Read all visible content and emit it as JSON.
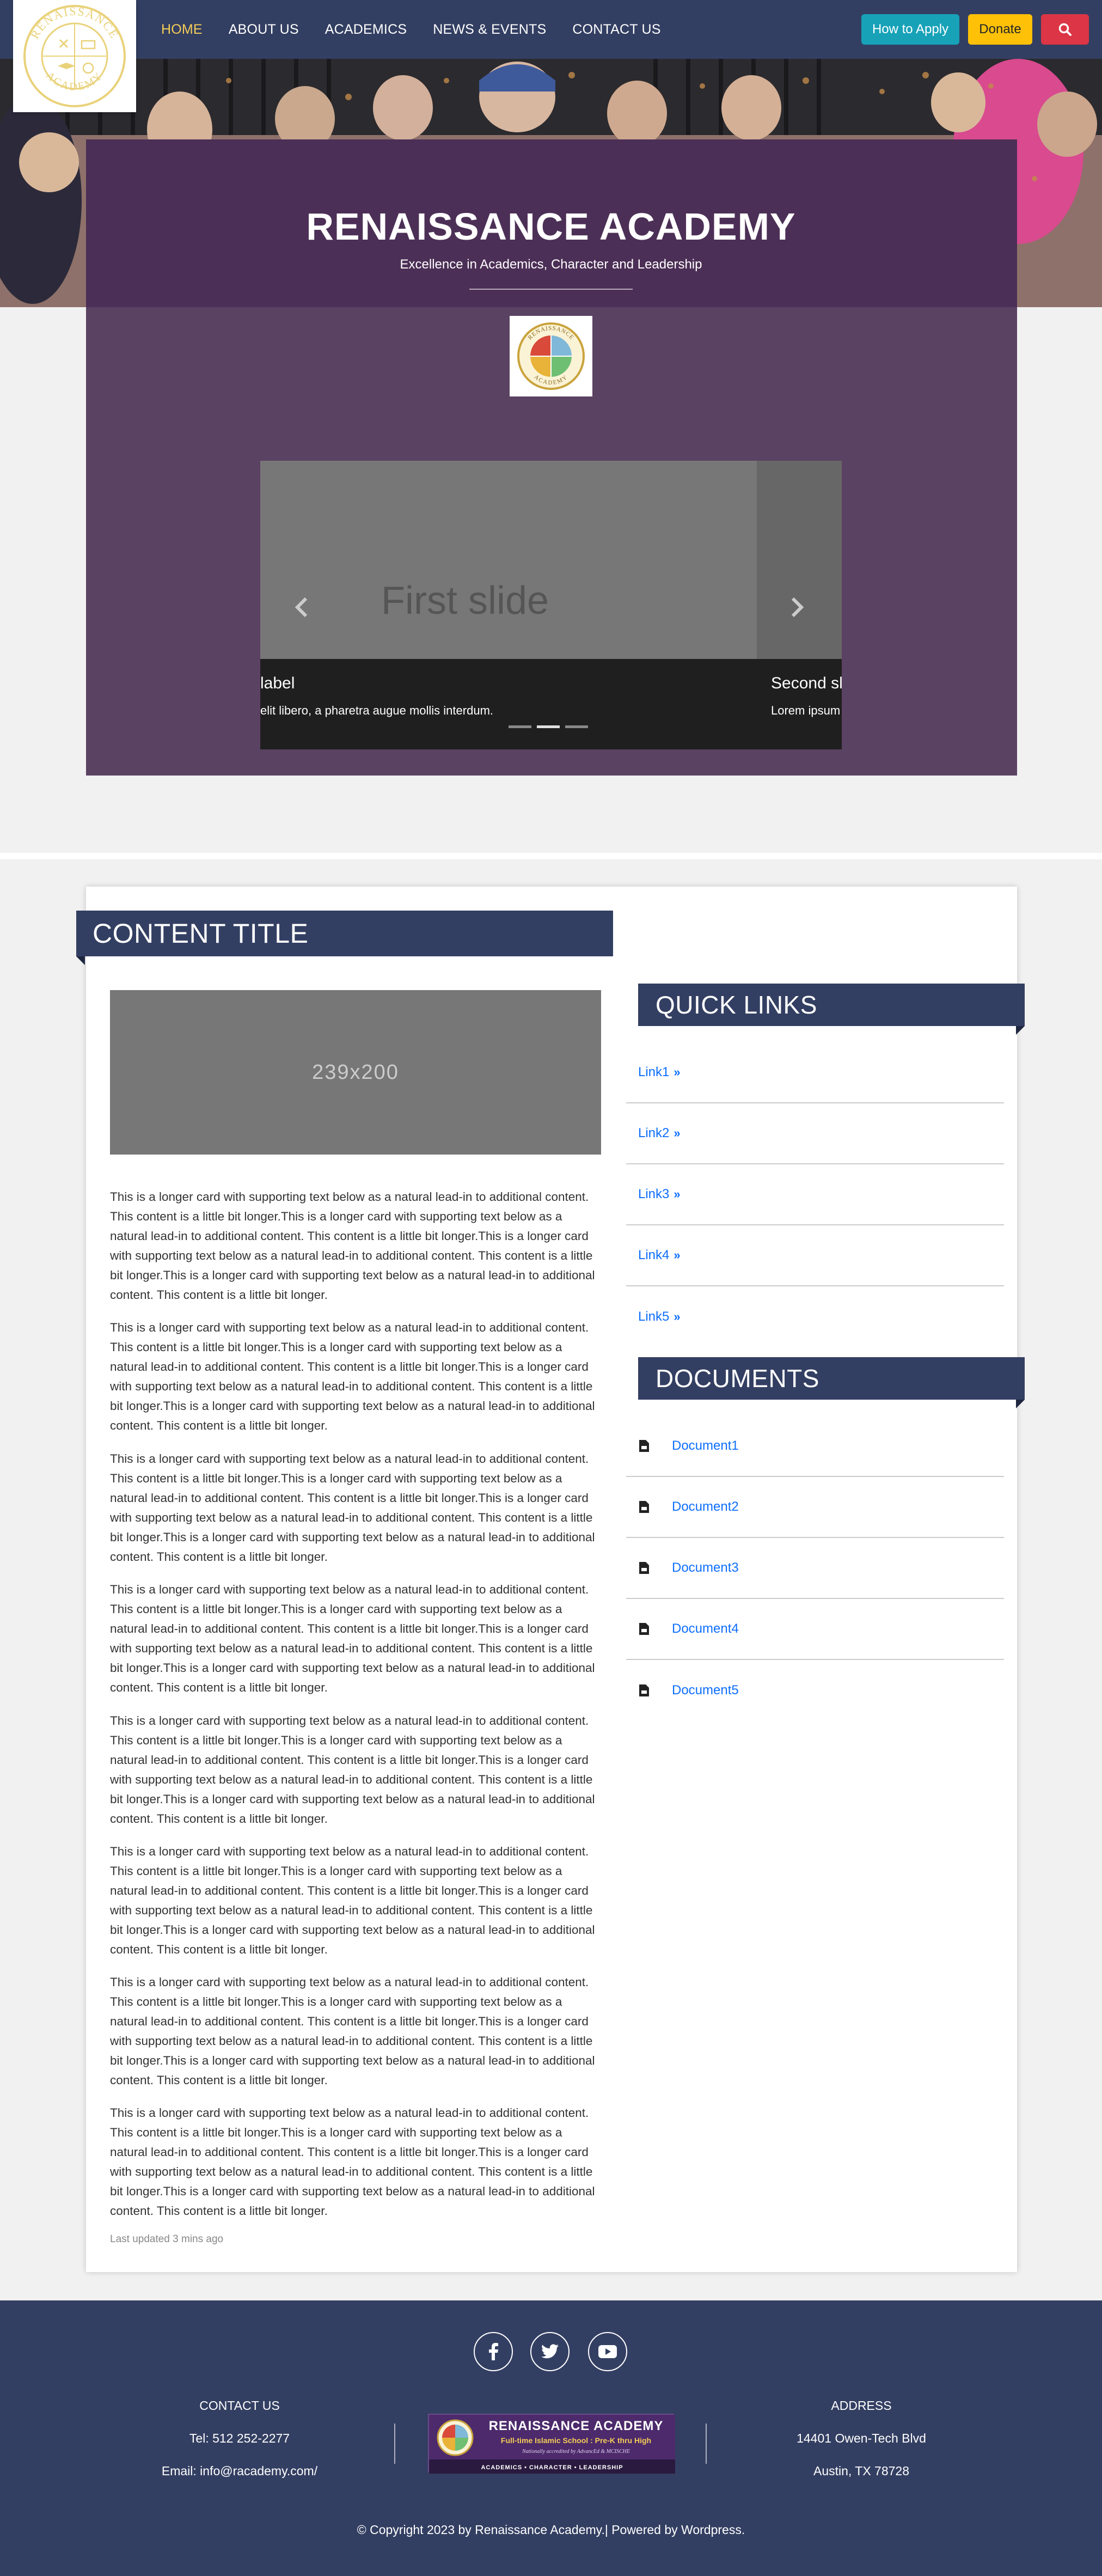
{
  "nav": {
    "links": [
      "HOME",
      "ABOUT US",
      "ACADEMICS",
      "NEWS & EVENTS",
      "CONTACT US"
    ],
    "apply_label": "How to Apply",
    "donate_label": "Donate",
    "search_icon": "search-icon",
    "logo_text_top": "RENAISSANCE",
    "logo_text_bottom": "ACADEMY"
  },
  "hero": {
    "title": "RENAISSANCE ACADEMY",
    "subtitle": "Excellence in Academics, Character and Leadership",
    "crest_top": "RENAISSANCE",
    "crest_bottom": "ACADEMY"
  },
  "carousel": {
    "slide1_label": "First slide",
    "caption1_title": "label",
    "caption1_text": "elit libero, a pharetra augue mollis interdum.",
    "caption2_title": "Second sli",
    "caption2_text": "Lorem ipsum",
    "prev_icon": "chevron-left-icon",
    "next_icon": "chevron-right-icon"
  },
  "content": {
    "title": "CONTENT TITLE",
    "image_placeholder": "239x200",
    "paragraph": "This is a longer card with supporting text below as a natural lead-in to additional content. This content is a little bit longer.This is a longer card with supporting text below as a natural lead-in to additional content. This content is a little bit longer.This is a longer card with supporting text below as a natural lead-in to additional content. This content is a little bit longer.This is a longer card with supporting text below as a natural lead-in to additional content. This content is a little bit longer.",
    "updated": "Last updated 3 mins ago"
  },
  "quick_links": {
    "title": "QUICK LINKS",
    "items": [
      "Link1",
      "Link2",
      "Link3",
      "Link4",
      "Link5"
    ]
  },
  "documents": {
    "title": "DOCUMENTS",
    "items": [
      "Document1",
      "Document2",
      "Document3",
      "Document4",
      "Document5"
    ]
  },
  "footer": {
    "contact_heading": "CONTACT US",
    "phone": "Tel: 512 252-2277",
    "email": "Email: info@racademy.com/",
    "address_heading": "ADDRESS",
    "address_line1": "14401 Owen-Tech Blvd",
    "address_line2": "Austin, TX 78728",
    "banner_title": "RENAISSANCE ACADEMY",
    "banner_sub": "Full-time Islamic School : Pre-K thru High",
    "banner_note": "Nationally accredited by AdvancEd & MCISCHE",
    "banner_motto": "ACADEMICS  •  CHARACTER  •  LEADERSHIP",
    "copyright": "© Copyright 2023 by Renaissance Academy.| Powered by Wordpress.",
    "social": [
      "facebook-icon",
      "twitter-icon",
      "youtube-icon"
    ]
  },
  "colors": {
    "navy": "#333f62",
    "hero_purple": "#5a4262",
    "link_blue": "#0d6efd",
    "apply": "#17a2b8",
    "donate": "#ffc107",
    "search": "#dc3545",
    "gold": "#f5cd58"
  }
}
